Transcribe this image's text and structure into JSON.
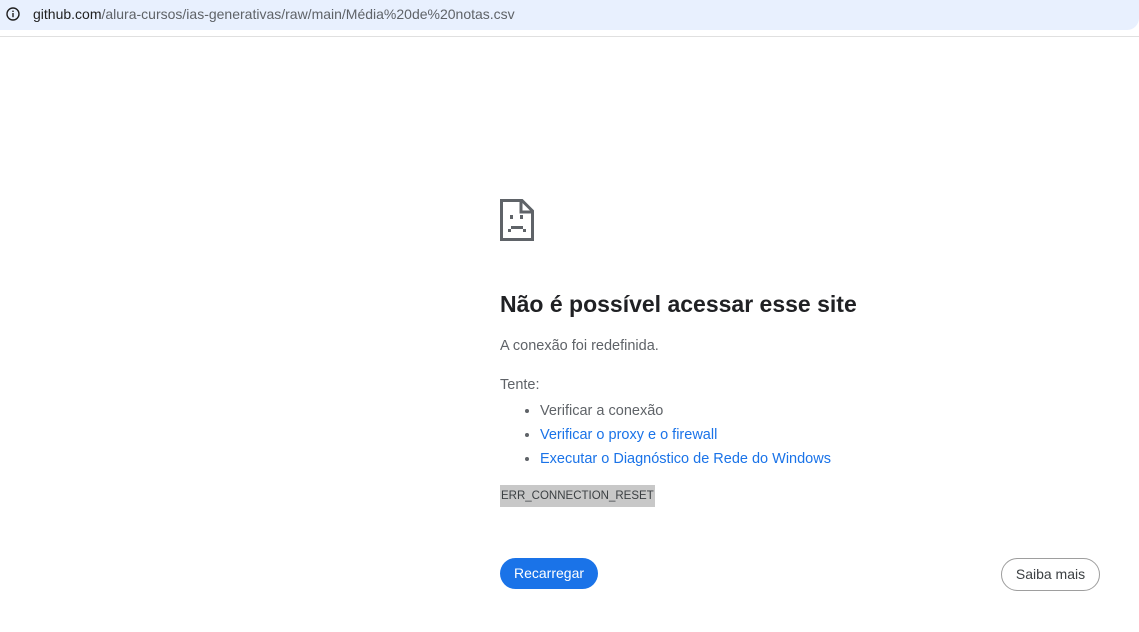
{
  "address_bar": {
    "url_host": "github.com",
    "url_path": "/alura-cursos/ias-generativas/raw/main/Média%20de%20notas.csv",
    "info_icon": "info-icon"
  },
  "error_page": {
    "icon": "sad-page-icon",
    "title": "Não é possível acessar esse site",
    "message": "A conexão foi redefinida.",
    "suggestions_label": "Tente:",
    "suggestions": [
      {
        "text": "Verificar a conexão"
      },
      {
        "text": "Verificar o proxy e o firewall"
      },
      {
        "text": "Executar o Diagnóstico de Rede do Windows"
      }
    ],
    "error_code": "ERR_CONNECTION_RESET",
    "reload_label": "Recarregar",
    "details_label": "Saiba mais"
  },
  "colors": {
    "address_bar_bg": "#e8f0fe",
    "link": "#1a73e8",
    "primary_button": "#1a73e8",
    "error_code_highlight": "#c8c8c8"
  }
}
